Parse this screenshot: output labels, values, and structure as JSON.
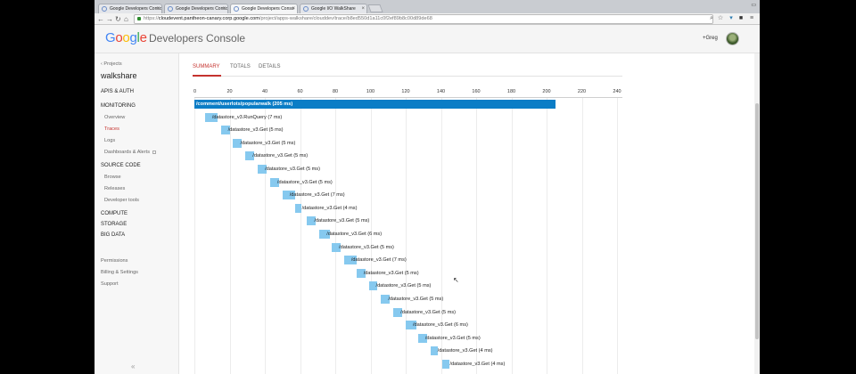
{
  "browser": {
    "tabs": [
      {
        "label": "Google Developers Conso",
        "active": false
      },
      {
        "label": "Google Developers Conso",
        "active": false
      },
      {
        "label": "Google Developers Conso",
        "active": true
      },
      {
        "label": "Google I/O WalkShare",
        "active": false
      }
    ],
    "url_scheme": "https://",
    "url_host": "cloudevent.pantheon-canary.corp.google.com",
    "url_path": "/project/apps-walkshare/clouddev/trace/b8ed550d1a11c0f2ef89b8c00d89de68"
  },
  "header": {
    "logo": "Google",
    "product": "Developers Console",
    "user": "+Greg"
  },
  "sidebar": {
    "projects_link": "‹ Projects",
    "project_name": "walkshare",
    "apis_auth": "APIS & AUTH",
    "monitoring": "MONITORING",
    "overview": "Overview",
    "traces": "Traces",
    "logs": "Logs",
    "dashboards": "Dashboards & Alerts",
    "source_code": "SOURCE CODE",
    "browse": "Browse",
    "releases": "Releases",
    "developer_tools": "Developer tools",
    "compute": "COMPUTE",
    "storage": "STORAGE",
    "big_data": "BIG DATA",
    "permissions": "Permissions",
    "billing": "Billing & Settings",
    "support": "Support",
    "collapse": "«"
  },
  "main": {
    "tabs": [
      {
        "label": "SUMMARY",
        "active": true
      },
      {
        "label": "TOTALS",
        "active": false
      },
      {
        "label": "DETAILS",
        "active": false
      }
    ]
  },
  "colors": {
    "root_bar": "#0b7dc6",
    "child_bar": "#86c9ef",
    "accent": "#c5322e"
  },
  "chart_data": {
    "type": "bar",
    "orientation": "horizontal-timeline",
    "x_ticks": [
      0,
      20,
      40,
      60,
      80,
      100,
      120,
      140,
      160,
      180,
      200,
      220,
      240
    ],
    "xlim": [
      0,
      240
    ],
    "spans": [
      {
        "label": "/comment/userlots/popularwalk (205 ms)",
        "start": 0,
        "duration": 205,
        "root": true
      },
      {
        "label": "/datastore_v3.RunQuery (7 ms)",
        "start": 6,
        "duration": 7
      },
      {
        "label": "/datastore_v3.Get (5 ms)",
        "start": 15,
        "duration": 5
      },
      {
        "label": "/datastore_v3.Get (5 ms)",
        "start": 22,
        "duration": 5
      },
      {
        "label": "/datastore_v3.Get (5 ms)",
        "start": 29,
        "duration": 5
      },
      {
        "label": "/datastore_v3.Get (5 ms)",
        "start": 36,
        "duration": 5
      },
      {
        "label": "/datastore_v3.Get (5 ms)",
        "start": 43,
        "duration": 5
      },
      {
        "label": "/datastore_v3.Get (7 ms)",
        "start": 50,
        "duration": 7
      },
      {
        "label": "/datastore_v3.Get (4 ms)",
        "start": 57,
        "duration": 4
      },
      {
        "label": "/datastore_v3.Get (5 ms)",
        "start": 64,
        "duration": 5
      },
      {
        "label": "/datastore_v3.Get (6 ms)",
        "start": 71,
        "duration": 6
      },
      {
        "label": "/datastore_v3.Get (5 ms)",
        "start": 78,
        "duration": 5
      },
      {
        "label": "/datastore_v3.Get (7 ms)",
        "start": 85,
        "duration": 7
      },
      {
        "label": "/datastore_v3.Get (5 ms)",
        "start": 92,
        "duration": 5
      },
      {
        "label": "/datastore_v3.Get (5 ms)",
        "start": 99,
        "duration": 5
      },
      {
        "label": "/datastore_v3.Get (5 ms)",
        "start": 106,
        "duration": 5
      },
      {
        "label": "/datastore_v3.Get (5 ms)",
        "start": 113,
        "duration": 5
      },
      {
        "label": "/datastore_v3.Get (6 ms)",
        "start": 120,
        "duration": 6
      },
      {
        "label": "/datastore_v3.Get (5 ms)",
        "start": 127,
        "duration": 5
      },
      {
        "label": "/datastore_v3.Get (4 ms)",
        "start": 134,
        "duration": 4
      },
      {
        "label": "/datastore_v3.Get (4 ms)",
        "start": 141,
        "duration": 4
      }
    ]
  }
}
